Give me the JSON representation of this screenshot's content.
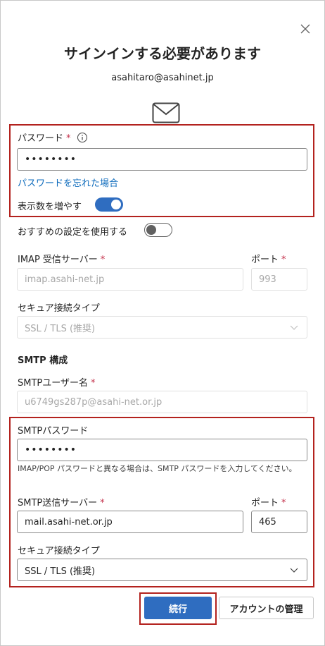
{
  "dialog": {
    "title": "サインインする必要があります",
    "email": "asahitaro@asahinet.jp"
  },
  "password": {
    "label": "パスワード",
    "required_mark": "*",
    "info_icon": "info-icon",
    "value": "••••••••",
    "forgot_link": "パスワードを忘れた場合"
  },
  "show_more": {
    "label": "表示数を増やす",
    "state": "on"
  },
  "recommended": {
    "label": "おすすめの設定を使用する",
    "state": "off"
  },
  "imap": {
    "server_label": "IMAP 受信サーバー",
    "required_mark": "*",
    "server_value": "imap.asahi-net.jp",
    "port_label": "ポート",
    "port_value": "993",
    "security_label": "セキュア接続タイプ",
    "security_value": "SSL / TLS (推奨)"
  },
  "smtp": {
    "section_title": "SMTP 構成",
    "username_label": "SMTPユーザー名",
    "required_mark": "*",
    "username_value": "u6749gs287p@asahi-net.or.jp",
    "password_label": "SMTPパスワード",
    "password_value": "••••••••",
    "hint": "IMAP/POP パスワードと異なる場合は、SMTP パスワードを入力してください。",
    "server_label": "SMTP送信サーバー",
    "server_value": "mail.asahi-net.or.jp",
    "port_label": "ポート",
    "port_value": "465",
    "security_label": "セキュア接続タイプ",
    "security_value": "SSL / TLS (推奨)"
  },
  "actions": {
    "continue": "続行",
    "manage_account": "アカウントの管理"
  },
  "colors": {
    "accent": "#2f6dc0",
    "highlight_border": "#b3221e",
    "link": "#0f6cbd",
    "required": "#c4314b"
  }
}
